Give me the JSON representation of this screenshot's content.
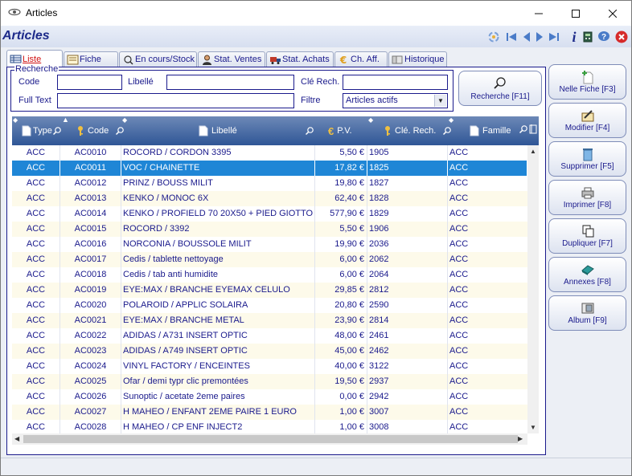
{
  "window": {
    "title": "Articles"
  },
  "header": {
    "title": "Articles"
  },
  "tabs": [
    {
      "label": "Liste"
    },
    {
      "label": "Fiche"
    },
    {
      "label": "En cours/Stock"
    },
    {
      "label": "Stat. Ventes"
    },
    {
      "label": "Stat. Achats"
    },
    {
      "label": "Ch. Aff."
    },
    {
      "label": "Historique"
    }
  ],
  "search": {
    "legend": "Recherche",
    "code_label": "Code",
    "code_value": "",
    "libelle_label": "Libellé",
    "libelle_value": "",
    "cle_label": "Clé Rech.",
    "cle_value": "",
    "fulltext_label": "Full Text",
    "fulltext_value": "",
    "filtre_label": "Filtre",
    "filtre_value": "Articles actifs",
    "button_label": "Recherche [F11]"
  },
  "grid": {
    "columns": [
      "Type",
      "Code",
      "Libellé",
      "P.V.",
      "Clé. Rech.",
      "Famille"
    ],
    "selected_index": 1,
    "rows": [
      [
        "ACC",
        "AC0010",
        "ROCORD / CORDON 3395",
        "5,50 €",
        "1905",
        "ACC"
      ],
      [
        "ACC",
        "AC0011",
        "VOC / CHAINETTE",
        "17,82 €",
        "1825",
        "ACC"
      ],
      [
        "ACC",
        "AC0012",
        "PRINZ / BOUSS MILIT",
        "19,80 €",
        "1827",
        "ACC"
      ],
      [
        "ACC",
        "AC0013",
        "KENKO / MONOC 6X",
        "62,40 €",
        "1828",
        "ACC"
      ],
      [
        "ACC",
        "AC0014",
        "KENKO / PROFIELD 70 20X50 + PIED GIOTTO",
        "577,90 €",
        "1829",
        "ACC"
      ],
      [
        "ACC",
        "AC0015",
        "ROCORD / 3392",
        "5,50 €",
        "1906",
        "ACC"
      ],
      [
        "ACC",
        "AC0016",
        "NORCONIA / BOUSSOLE MILIT",
        "19,90 €",
        "2036",
        "ACC"
      ],
      [
        "ACC",
        "AC0017",
        "Cedis / tablette nettoyage",
        "6,00 €",
        "2062",
        "ACC"
      ],
      [
        "ACC",
        "AC0018",
        "Cedis / tab anti humidite",
        "6,00 €",
        "2064",
        "ACC"
      ],
      [
        "ACC",
        "AC0019",
        "EYE:MAX / BRANCHE EYEMAX CELULO",
        "29,85 €",
        "2812",
        "ACC"
      ],
      [
        "ACC",
        "AC0020",
        "POLAROID / APPLIC SOLAIRA",
        "20,80 €",
        "2590",
        "ACC"
      ],
      [
        "ACC",
        "AC0021",
        "EYE:MAX / BRANCHE METAL",
        "23,90 €",
        "2814",
        "ACC"
      ],
      [
        "ACC",
        "AC0022",
        "ADIDAS / A731 INSERT OPTIC",
        "48,00 €",
        "2461",
        "ACC"
      ],
      [
        "ACC",
        "AC0023",
        "ADIDAS / A749 INSERT OPTIC",
        "45,00 €",
        "2462",
        "ACC"
      ],
      [
        "ACC",
        "AC0024",
        "VINYL FACTORY / ENCEINTES",
        "40,00 €",
        "3122",
        "ACC"
      ],
      [
        "ACC",
        "AC0025",
        "Ofar / demi typr clic premontées",
        "19,50 €",
        "2937",
        "ACC"
      ],
      [
        "ACC",
        "AC0026",
        "Sunoptic / acetate 2eme paires",
        "0,00 €",
        "2942",
        "ACC"
      ],
      [
        "ACC",
        "AC0027",
        "H MAHEO / ENFANT 2EME PAIRE 1 EURO",
        "1,00 €",
        "3007",
        "ACC"
      ],
      [
        "ACC",
        "AC0028",
        "H MAHEO / CP ENF INJECT2",
        "1,00 €",
        "3008",
        "ACC"
      ]
    ]
  },
  "actions": [
    {
      "label": "Nelle Fiche [F3]",
      "icon": "new-document-icon"
    },
    {
      "label": "Modifier [F4]",
      "icon": "edit-icon"
    },
    {
      "label": "Supprimer [F5]",
      "icon": "trash-icon"
    },
    {
      "label": "Imprimer [F8]",
      "icon": "printer-icon"
    },
    {
      "label": "Dupliquer [F7]",
      "icon": "duplicate-icon"
    },
    {
      "label": "Annexes [F8]",
      "icon": "annex-icon"
    },
    {
      "label": "Album [F9]",
      "icon": "album-icon"
    }
  ],
  "colors": {
    "selection": "#1f86d6",
    "alt_row": "#fdfaea",
    "header_gradient_top": "#6d89b7",
    "header_gradient_bottom": "#2f5696",
    "text": "#1a1a8c"
  }
}
